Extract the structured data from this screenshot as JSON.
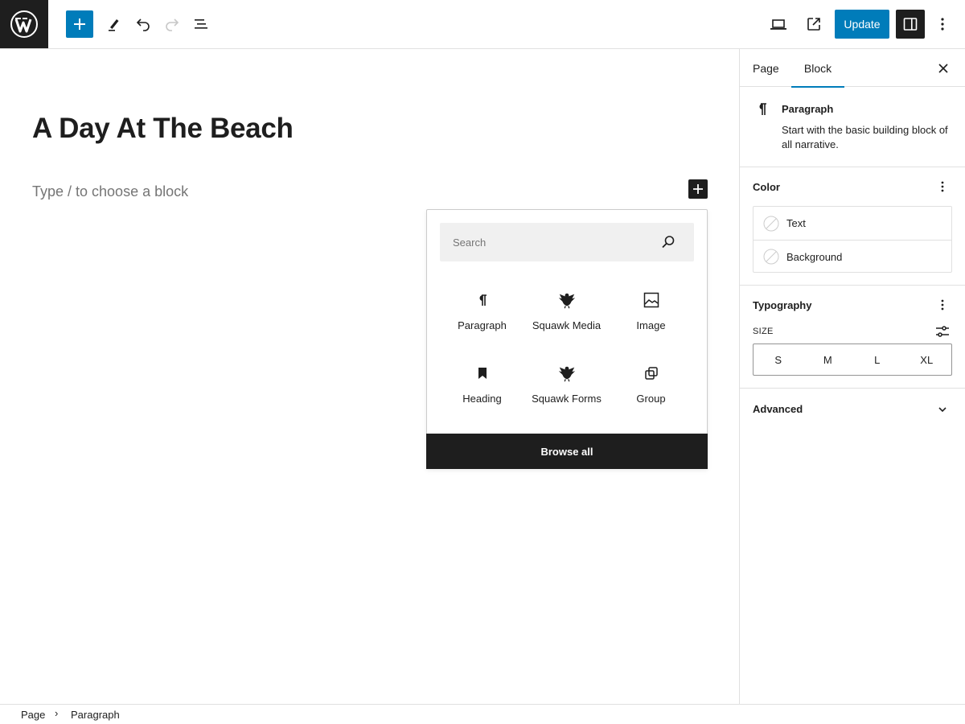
{
  "toolbar": {
    "update_label": "Update",
    "icons": [
      "wordpress-logo",
      "plus",
      "pencil",
      "undo",
      "redo",
      "list-view",
      "desktop-preview",
      "external-link",
      "settings-sidebar",
      "more-vertical"
    ]
  },
  "editor": {
    "title": "A Day At The Beach",
    "block_placeholder": "Type / to choose a block"
  },
  "inserter": {
    "search_placeholder": "Search",
    "items": [
      {
        "label": "Paragraph",
        "icon": "paragraph"
      },
      {
        "label": "Squawk Media",
        "icon": "bird"
      },
      {
        "label": "Image",
        "icon": "image"
      },
      {
        "label": "Heading",
        "icon": "bookmark"
      },
      {
        "label": "Squawk Forms",
        "icon": "bird"
      },
      {
        "label": "Group",
        "icon": "group"
      }
    ],
    "browse_all_label": "Browse all"
  },
  "sidebar": {
    "tabs": [
      {
        "label": "Page",
        "active": false
      },
      {
        "label": "Block",
        "active": true
      }
    ],
    "block_card": {
      "title": "Paragraph",
      "description": "Start with the basic building block of all narrative."
    },
    "color": {
      "title": "Color",
      "items": [
        "Text",
        "Background"
      ]
    },
    "typography": {
      "title": "Typography",
      "size_label": "SIZE",
      "size_options": [
        "S",
        "M",
        "L",
        "XL"
      ]
    },
    "advanced": {
      "title": "Advanced"
    }
  },
  "breadcrumb": {
    "items": [
      "Page",
      "Paragraph"
    ],
    "separator": "›"
  },
  "colors": {
    "accent": "#007cba",
    "dark": "#1e1e1e",
    "border": "#e0e0e0",
    "muted": "#757575"
  }
}
